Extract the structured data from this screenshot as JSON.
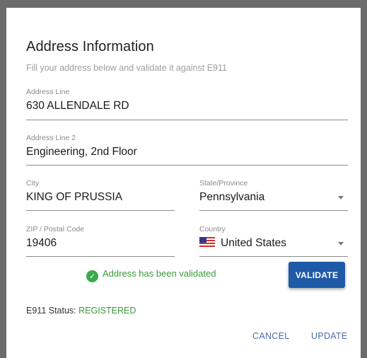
{
  "dialog": {
    "title": "Address Information",
    "subtitle": "Fill your address below and validate it against E911"
  },
  "fields": {
    "address_line": {
      "label": "Address Line",
      "value": "630 ALLENDALE RD"
    },
    "address_line2": {
      "label": "Address Line 2",
      "value": "Engineering, 2nd Floor"
    },
    "city": {
      "label": "City",
      "value": "KING OF PRUSSIA"
    },
    "state": {
      "label": "State/Province",
      "value": "Pennsylvania"
    },
    "zip": {
      "label": "ZIP / Postal Code",
      "value": "19406"
    },
    "country": {
      "label": "Country",
      "value": "United States",
      "flag_icon": "us-flag-icon"
    }
  },
  "validation": {
    "message": "Address has been validated",
    "icon": "check-circle-icon",
    "color": "#3a9a3a",
    "button_label": "VALIDATE",
    "button_color": "#1e5aa8"
  },
  "status": {
    "label": "E911 Status: ",
    "value": "REGISTERED"
  },
  "actions": {
    "cancel_label": "CANCEL",
    "update_label": "UPDATE"
  }
}
